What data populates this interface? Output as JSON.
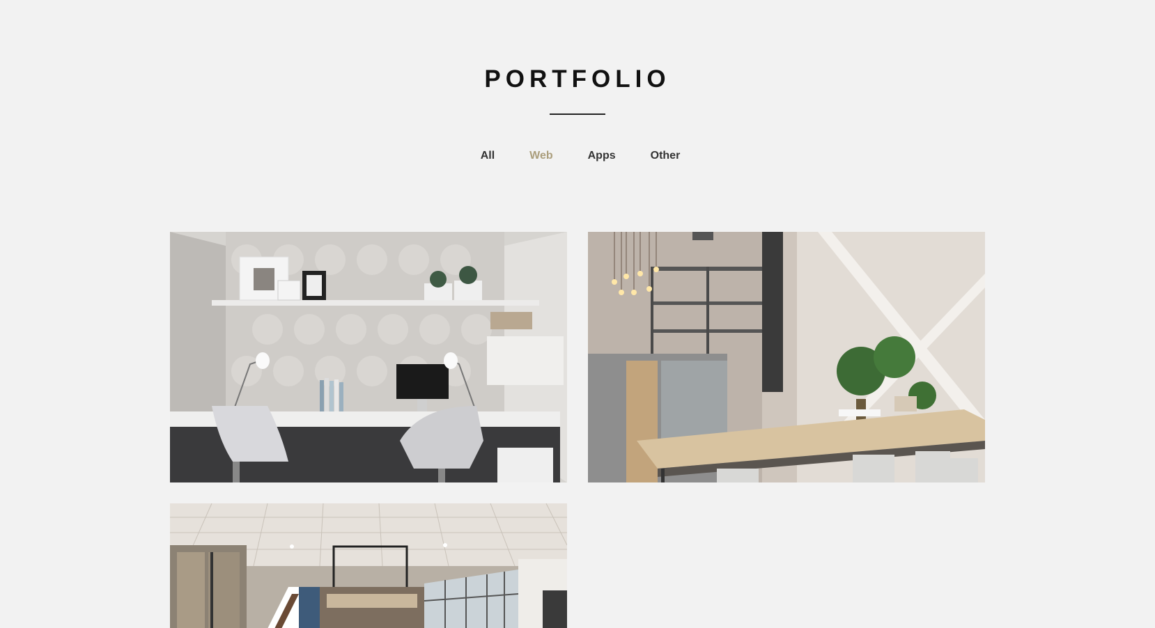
{
  "portfolio": {
    "title": "PORTFOLIO",
    "filters": [
      {
        "label": "All",
        "active": false
      },
      {
        "label": "Web",
        "active": true
      },
      {
        "label": "Apps",
        "active": false
      },
      {
        "label": "Other",
        "active": false
      }
    ],
    "accent_color": "#ab9e7c",
    "items": [
      {
        "image": "home-office-photo"
      },
      {
        "image": "coworking-space-photo"
      },
      {
        "image": "office-lobby-photo"
      }
    ]
  }
}
